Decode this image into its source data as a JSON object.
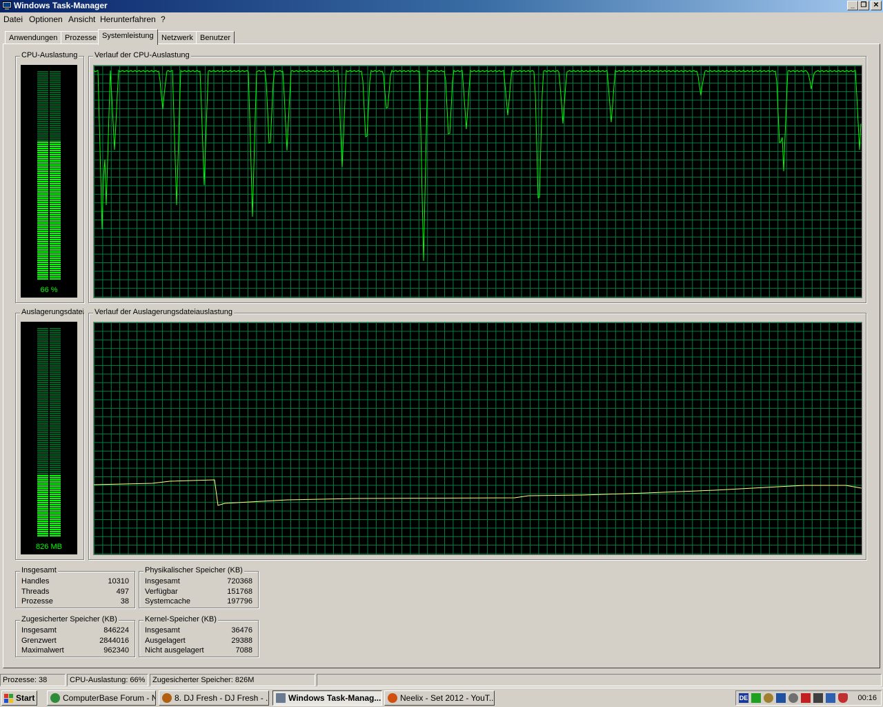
{
  "window": {
    "title": "Windows Task-Manager",
    "minimize": "_",
    "restore": "❐",
    "close": "✕"
  },
  "menu": [
    "Datei",
    "Optionen",
    "Ansicht",
    "Herunterfahren",
    "?"
  ],
  "tabs": [
    "Anwendungen",
    "Prozesse",
    "Systemleistung",
    "Netzwerk",
    "Benutzer"
  ],
  "active_tab": "Systemleistung",
  "cpu": {
    "group_label": "CPU-Auslastung",
    "value_label": "66 %",
    "fill_fraction": 0.66,
    "history_label": "Verlauf der CPU-Auslastung"
  },
  "pagefile": {
    "group_label": "Auslagerungsdatei",
    "value_label": "826 MB",
    "fill_fraction": 0.3,
    "history_label": "Verlauf der Auslagerungsdateiauslastung"
  },
  "totals": {
    "label": "Insgesamt",
    "rows": [
      {
        "key": "Handles",
        "value": "10310"
      },
      {
        "key": "Threads",
        "value": "497"
      },
      {
        "key": "Prozesse",
        "value": "38"
      }
    ]
  },
  "physical": {
    "label": "Physikalischer Speicher (KB)",
    "rows": [
      {
        "key": "Insgesamt",
        "value": "720368"
      },
      {
        "key": "Verfügbar",
        "value": "151768"
      },
      {
        "key": "Systemcache",
        "value": "197796"
      }
    ]
  },
  "commit": {
    "label": "Zugesicherter Speicher (KB)",
    "rows": [
      {
        "key": "Insgesamt",
        "value": "846224"
      },
      {
        "key": "Grenzwert",
        "value": "2844016"
      },
      {
        "key": "Maximalwert",
        "value": "962340"
      }
    ]
  },
  "kernel": {
    "label": "Kernel-Speicher (KB)",
    "rows": [
      {
        "key": "Insgesamt",
        "value": "36476"
      },
      {
        "key": "Ausgelagert",
        "value": "29388"
      },
      {
        "key": "Nicht ausgelagert",
        "value": "7088"
      }
    ]
  },
  "status": {
    "processes": "Prozesse: 38",
    "cpu": "CPU-Auslastung: 66%",
    "commit": "Zugesicherter Speicher: 826M"
  },
  "taskbar": {
    "start": "Start",
    "buttons": [
      {
        "label": "ComputerBase Forum - N...",
        "icon_color": "#2e8b3a"
      },
      {
        "label": "8. DJ Fresh - DJ Fresh - ...",
        "icon_color": "#b06010"
      },
      {
        "label": "Windows Task-Manag...",
        "icon_color": "#6a7a90"
      },
      {
        "label": "Neelix - Set 2012 - YouT...",
        "icon_color": "#d05010"
      }
    ],
    "active_button": "Windows Task-Manag...",
    "tray_lang": "DE",
    "clock": "00:16"
  },
  "colors": {
    "graph_grid": "#008040",
    "cpu_line": "#00ff00",
    "pf_line": "#ffff80",
    "meter_on": "#00ff00",
    "meter_off": "#006020"
  }
}
